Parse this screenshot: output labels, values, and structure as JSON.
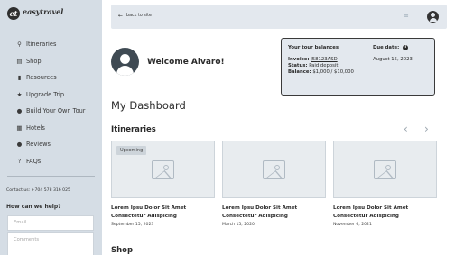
{
  "brand": {
    "mark": "et",
    "name": "easytravel"
  },
  "sidebar": {
    "items": [
      {
        "icon": "map-icon",
        "glyph": "⚲",
        "label": "Itineraries"
      },
      {
        "icon": "cart-icon",
        "glyph": "🛒",
        "label": "Shop"
      },
      {
        "icon": "document-icon",
        "glyph": "▮",
        "label": "Resources"
      },
      {
        "icon": "star-icon",
        "glyph": "★",
        "label": "Upgrade Trip"
      },
      {
        "icon": "tour-icon",
        "glyph": "●",
        "label": "Build Your Own Tour"
      },
      {
        "icon": "hotel-icon",
        "glyph": "▦",
        "label": "Hotels"
      },
      {
        "icon": "chat-icon",
        "glyph": "●",
        "label": "Reviews"
      },
      {
        "icon": "question-icon",
        "glyph": "?",
        "label": "FAQs"
      }
    ],
    "contact": "Contact us: +704 578 316 025",
    "help_title": "How can we help?",
    "email_placeholder": "Email",
    "comments_placeholder": "Comments"
  },
  "topbar": {
    "back_label": "back to site",
    "back_glyph": "←",
    "menu_glyph": "≡"
  },
  "welcome": "Welcome Alvaro!",
  "balances": {
    "title": "Your tour balances",
    "due_label": "Due date:",
    "due_date": "August 15, 2023",
    "invoice_label": "Invoice:",
    "invoice_number": "J58123ASD",
    "status_label": "Status:",
    "status_value": "Paid deposit",
    "balance_label": "Balance:",
    "balance_value": "$1,000 / $10,000"
  },
  "dashboard_title": "My Dashboard",
  "itineraries": {
    "title": "Itineraries",
    "prev_glyph": "‹",
    "next_glyph": "›",
    "cards": [
      {
        "badge": "Upcoming",
        "title": "Lorem Ipsu Dolor Sit Amet Consectetur Adispicing",
        "date": "September 15, 2023"
      },
      {
        "badge": "",
        "title": "Lorem Ipsu Dolor Sit Amet Consectetur Adispicing",
        "date": "March 15, 2020"
      },
      {
        "badge": "",
        "title": "Lorem Ipsu Dolor Sit Amet Consectetur Adispicing",
        "date": "November 6, 2021"
      }
    ]
  },
  "shop": {
    "title": "Shop"
  }
}
